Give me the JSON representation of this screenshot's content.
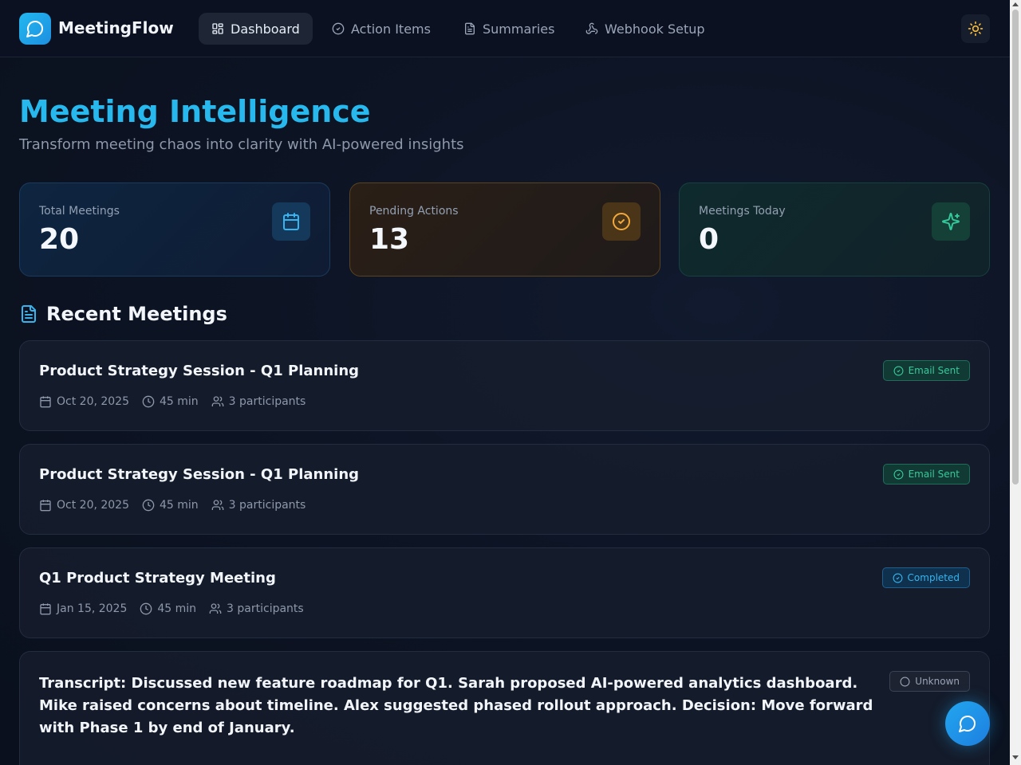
{
  "app": {
    "name": "MeetingFlow"
  },
  "nav": {
    "items": [
      {
        "label": "Dashboard",
        "icon": "dashboard-grid-icon",
        "active": true
      },
      {
        "label": "Action Items",
        "icon": "check-circle-icon"
      },
      {
        "label": "Summaries",
        "icon": "document-icon"
      },
      {
        "label": "Webhook Setup",
        "icon": "webhook-icon"
      }
    ],
    "theme_toggle_icon": "sun-icon"
  },
  "hero": {
    "title": "Meeting Intelligence",
    "subtitle": "Transform meeting chaos into clarity with AI-powered insights"
  },
  "stats": [
    {
      "label": "Total Meetings",
      "value": "20",
      "icon": "calendar-icon",
      "color": "#38b3ee"
    },
    {
      "label": "Pending Actions",
      "value": "13",
      "icon": "check-circle-icon",
      "color": "#f2a93b"
    },
    {
      "label": "Meetings Today",
      "value": "0",
      "icon": "sparkles-icon",
      "color": "#34c79a"
    }
  ],
  "recent": {
    "title": "Recent Meetings",
    "meetings": [
      {
        "title": "Product Strategy Session - Q1 Planning",
        "date": "Oct 20, 2025",
        "duration": "45 min",
        "participants": "3 participants",
        "status": "Email Sent"
      },
      {
        "title": "Product Strategy Session - Q1 Planning",
        "date": "Oct 20, 2025",
        "duration": "45 min",
        "participants": "3 participants",
        "status": "Email Sent"
      },
      {
        "title": "Q1 Product Strategy Meeting",
        "date": "Jan 15, 2025",
        "duration": "45 min",
        "participants": "3 participants",
        "status": "Completed"
      },
      {
        "title": "Transcript: Discussed new feature roadmap for Q1. Sarah proposed AI-powered analytics dashboard. Mike raised concerns about timeline. Alex suggested phased rollout approach. Decision: Move forward with Phase 1 by end of January.",
        "status": "Unknown"
      }
    ]
  },
  "chat_button_icon": "chat-bubble-icon"
}
